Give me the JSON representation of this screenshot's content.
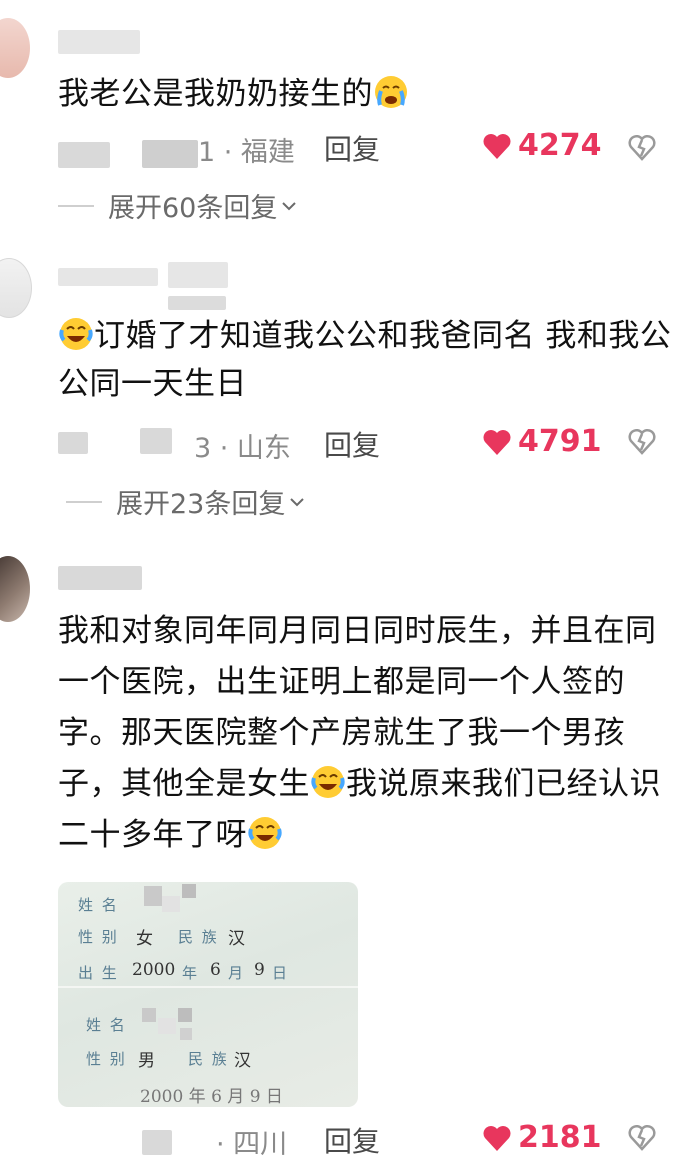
{
  "comments": [
    {
      "text": "我老公是我奶奶接生的",
      "meta_suffix": "1 · 福建",
      "reply_label": "回复",
      "likes": "4274",
      "expand_label": "展开60条回复"
    },
    {
      "text": "订婚了才知道我公公和我爸同名   我和我公公同一天生日",
      "meta_suffix": "3 · 山东",
      "reply_label": "回复",
      "likes": "4791",
      "expand_label": "展开23条回复"
    },
    {
      "text_part1": "我和对象同年同月同日同时辰生，并且在同一个医院，出生证明上都是同一个人签的字。那天医院整个产房就生了我一个男孩子，其他全是女生",
      "text_part2": "我说原来我们已经认识二十多年了呀",
      "photo": {
        "top": {
          "name_label": "姓 名",
          "gender_label": "性 别",
          "gender": "女",
          "ethnic_label": "民 族",
          "ethnic": "汉",
          "birth_label": "出 生",
          "birth_year": "2000",
          "year_char": "年",
          "month": "6",
          "month_char": "月",
          "day": "9",
          "day_char": "日"
        },
        "bottom": {
          "name_label": "姓 名",
          "gender_label": "性 别",
          "gender": "男",
          "ethnic_label": "民 族",
          "ethnic": "汉",
          "birth_partial": "2000  年  6  月  9  日"
        }
      },
      "meta_suffix": "· 四川",
      "reply_label": "回复",
      "likes": "2181"
    }
  ],
  "icons": {
    "like": "heart-icon",
    "dislike": "broken-heart-icon",
    "expand": "chevron-down-icon",
    "emoji_cry": "crying-emoji-icon",
    "emoji_laugh": "laughing-tears-emoji-icon"
  },
  "colors": {
    "like": "#e8365d",
    "meta": "#8a8a8a"
  }
}
